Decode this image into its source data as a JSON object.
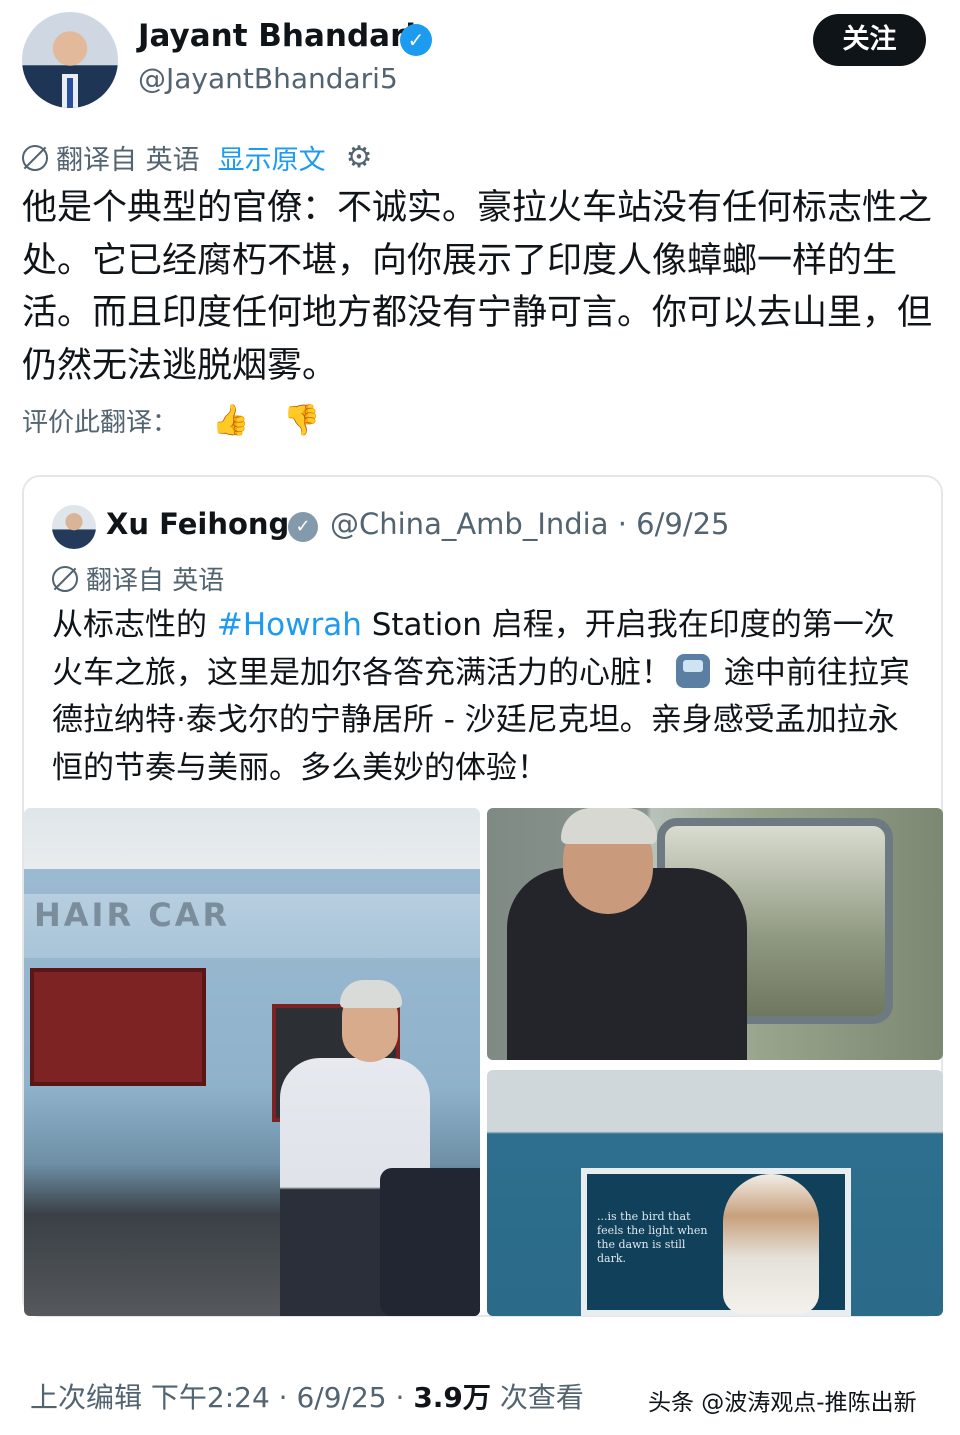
{
  "author": {
    "name": "Jayant Bhandari",
    "handle": "@JayantBhandari5",
    "follow_label": "关注"
  },
  "translation_bar": {
    "translated_from": "翻译自 英语",
    "show_original": "显示原文"
  },
  "post": {
    "text": "他是个典型的官僚：不诚实。豪拉火车站没有任何标志性之处。它已经腐朽不堪，向你展示了印度人像蟑螂一样的生活。而且印度任何地方都没有宁静可言。你可以去山里，但仍然无法逃脱烟雾。"
  },
  "rate_translation": {
    "label": "评价此翻译："
  },
  "quoted": {
    "name": "Xu Feihong",
    "handle_date": "@China_Amb_India · 6/9/25",
    "translated_from": "翻译自 英语",
    "text_before": "从标志性的 ",
    "hashtag": "#Howrah",
    "text_middle": " Station 启程，开启我在印度的第一次火车之旅，这里是加尔各答充满活力的心脏！",
    "text_after": " 途中前往拉宾德拉纳特·泰戈尔的宁静居所 - 沙廷尼克坦。亲身感受孟加拉永恒的节奏与美丽。多么美妙的体验！",
    "photo1_sign": "HAIR CAR",
    "photo3_quote": "...is the bird that feels the light when the dawn is still dark."
  },
  "footer": {
    "edited": "上次编辑 下午2:24 · 6/9/25 · ",
    "views_count": "3.9万",
    "views_label": " 次查看"
  },
  "watermark": "头条 @波涛观点-推陈出新",
  "colors": {
    "link": "#1d9bf0",
    "text": "#0f1419",
    "secondary": "#536471",
    "follow_bg": "#0f1419"
  }
}
